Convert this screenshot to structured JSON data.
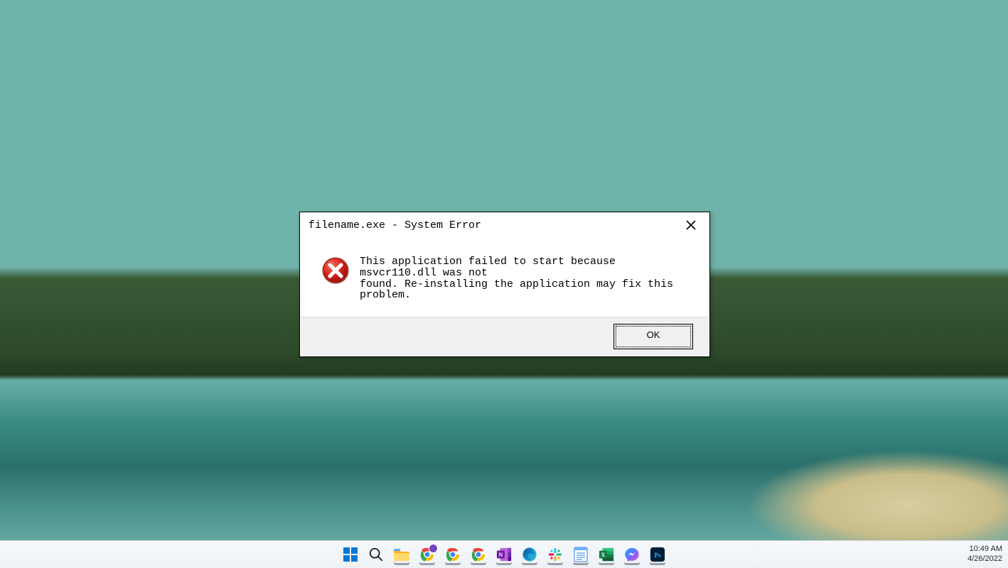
{
  "dialog": {
    "title": "filename.exe - System Error",
    "message": "This application failed to start because msvcr110.dll was not\nfound. Re-installing the application may fix this problem.",
    "ok_label": "OK"
  },
  "taskbar": {
    "apps": [
      {
        "name": "start",
        "icon": "windows-logo-icon"
      },
      {
        "name": "search",
        "icon": "search-icon"
      },
      {
        "name": "file-explorer",
        "icon": "folder-icon"
      },
      {
        "name": "chrome-profile-1",
        "icon": "chrome-icon"
      },
      {
        "name": "chrome-profile-2",
        "icon": "chrome-icon"
      },
      {
        "name": "chrome-profile-3",
        "icon": "chrome-icon"
      },
      {
        "name": "onenote",
        "icon": "onenote-icon"
      },
      {
        "name": "edge",
        "icon": "edge-icon"
      },
      {
        "name": "slack",
        "icon": "slack-icon"
      },
      {
        "name": "notepad",
        "icon": "notepad-icon"
      },
      {
        "name": "excel",
        "icon": "excel-icon"
      },
      {
        "name": "messenger",
        "icon": "messenger-icon"
      },
      {
        "name": "photoshop",
        "icon": "photoshop-icon"
      }
    ],
    "clock": {
      "time": "10:49 AM",
      "date": "4/26/2022"
    }
  }
}
